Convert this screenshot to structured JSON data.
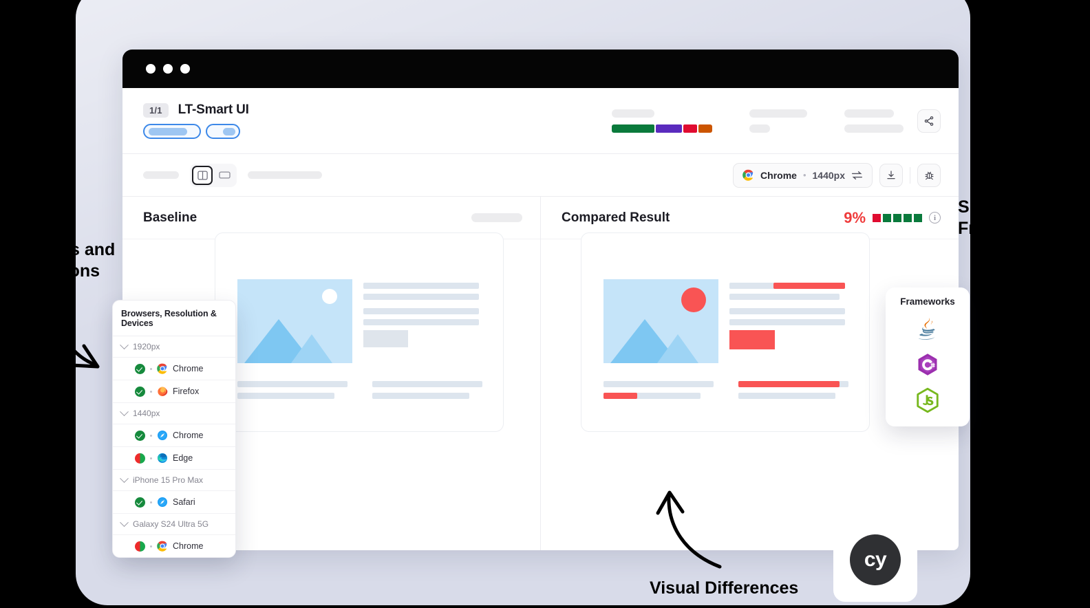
{
  "window": {
    "traffic_lights": [
      "dot-1",
      "dot-2",
      "dot-3"
    ],
    "header": {
      "count_badge": "1/1",
      "title": "LT-Smart UI",
      "share_icon": "share-icon",
      "segment_colors": [
        "#0a7a3c",
        "#5a2bbe",
        "#e00b30",
        "#cc5500"
      ]
    },
    "toolbar": {
      "view_split_icon": "split-view-icon",
      "view_single_icon": "single-view-icon",
      "browser_name": "Chrome",
      "separator": "•",
      "resolution": "1440px",
      "swap_icon": "swap-arrows-icon",
      "download_icon": "download-icon",
      "bug_icon": "bug-icon"
    },
    "panes": {
      "baseline": {
        "title": "Baseline"
      },
      "compared": {
        "title": "Compared Result",
        "diff_percent": "9%",
        "diff_percent_color": "#ef3b3b",
        "blocks": [
          "#e00b30",
          "#0a7a3c",
          "#0a7a3c",
          "#0a7a3c",
          "#0a7a3c"
        ],
        "info_icon": "info-icon",
        "info_glyph": "i"
      }
    }
  },
  "browsers_popover": {
    "title": "Browsers, Resolution & Devices",
    "groups": [
      {
        "label": "1920px",
        "chevron_icon": "chevron-down-icon",
        "rows": [
          {
            "status": "ok",
            "browser": "Chrome",
            "icon": "chrome-icon"
          },
          {
            "status": "ok",
            "browser": "Firefox",
            "icon": "firefox-icon"
          }
        ]
      },
      {
        "label": "1440px",
        "chevron_icon": "chevron-down-icon",
        "rows": [
          {
            "status": "ok",
            "browser": "Chrome",
            "icon": "safari-icon"
          },
          {
            "status": "half",
            "browser": "Edge",
            "icon": "edge-icon"
          }
        ]
      },
      {
        "label": "iPhone 15 Pro Max",
        "chevron_icon": "chevron-down-icon",
        "rows": [
          {
            "status": "ok",
            "browser": "Safari",
            "icon": "safari-icon"
          }
        ]
      },
      {
        "label": "Galaxy S24 Ultra 5G",
        "chevron_icon": "chevron-down-icon",
        "rows": [
          {
            "status": "half",
            "browser": "Chrome",
            "icon": "chrome-icon"
          }
        ]
      }
    ]
  },
  "frameworks_card": {
    "title": "Frameworks",
    "items": [
      {
        "name": "Java",
        "icon": "java-icon"
      },
      {
        "name": "C#",
        "icon": "csharp-icon"
      },
      {
        "name": "JavaScript",
        "icon": "nodejs-icon"
      }
    ]
  },
  "cypress_badge": {
    "label": "cy",
    "icon": "cypress-logo"
  },
  "annotations": {
    "left": "Browsers and\nResolutions",
    "right": "Supported\nFrameworks",
    "bottom": "Visual Differences"
  }
}
